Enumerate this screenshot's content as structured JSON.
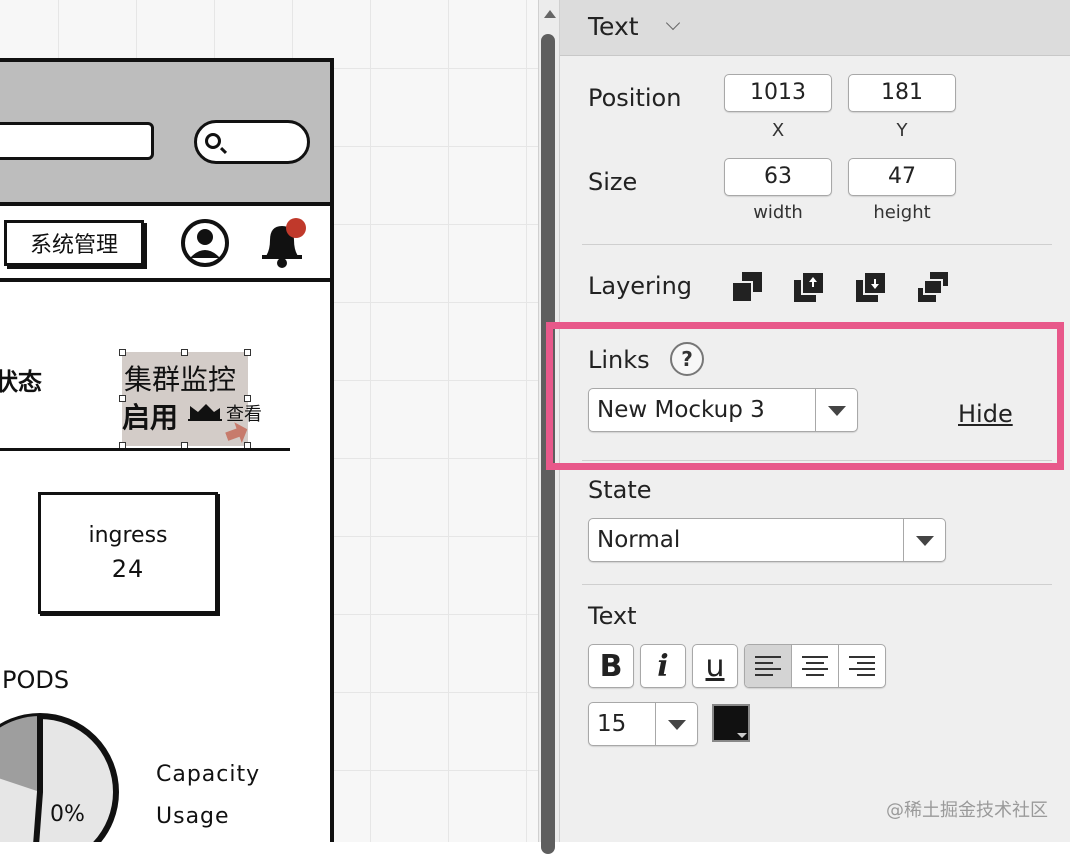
{
  "canvas": {
    "mockup": {
      "system_button": "系统管理",
      "status_text": "状态",
      "cluster_line1": "集群监控",
      "cluster_line2": "启用",
      "view_text": "查看",
      "ingress_title": "ingress",
      "ingress_value": "24",
      "pods_label": "PODS",
      "pie_percent": "0%",
      "capacity_line1": "Capacity",
      "capacity_line2": "Usage"
    }
  },
  "panel": {
    "title": "Text",
    "position": {
      "label": "Position",
      "x_value": "1013",
      "y_value": "181",
      "x_label": "X",
      "y_label": "Y"
    },
    "size": {
      "label": "Size",
      "width_value": "63",
      "height_value": "47",
      "width_label": "width",
      "height_label": "height"
    },
    "layering": {
      "label": "Layering",
      "icons": [
        "bring-to-front-icon",
        "bring-forward-icon",
        "send-backward-icon",
        "send-to-back-icon"
      ]
    },
    "links": {
      "label": "Links",
      "help_symbol": "?",
      "selected": "New Mockup 3",
      "hide_label": "Hide",
      "highlight_color": "#e8588a"
    },
    "state": {
      "label": "State",
      "selected": "Normal"
    },
    "text": {
      "label": "Text",
      "bold_label": "B",
      "italic_label": "i",
      "underline_label": "u",
      "active_alignment": "left",
      "font_size": "15",
      "color": "#111111"
    }
  },
  "watermark": "@稀土掘金技术社区"
}
